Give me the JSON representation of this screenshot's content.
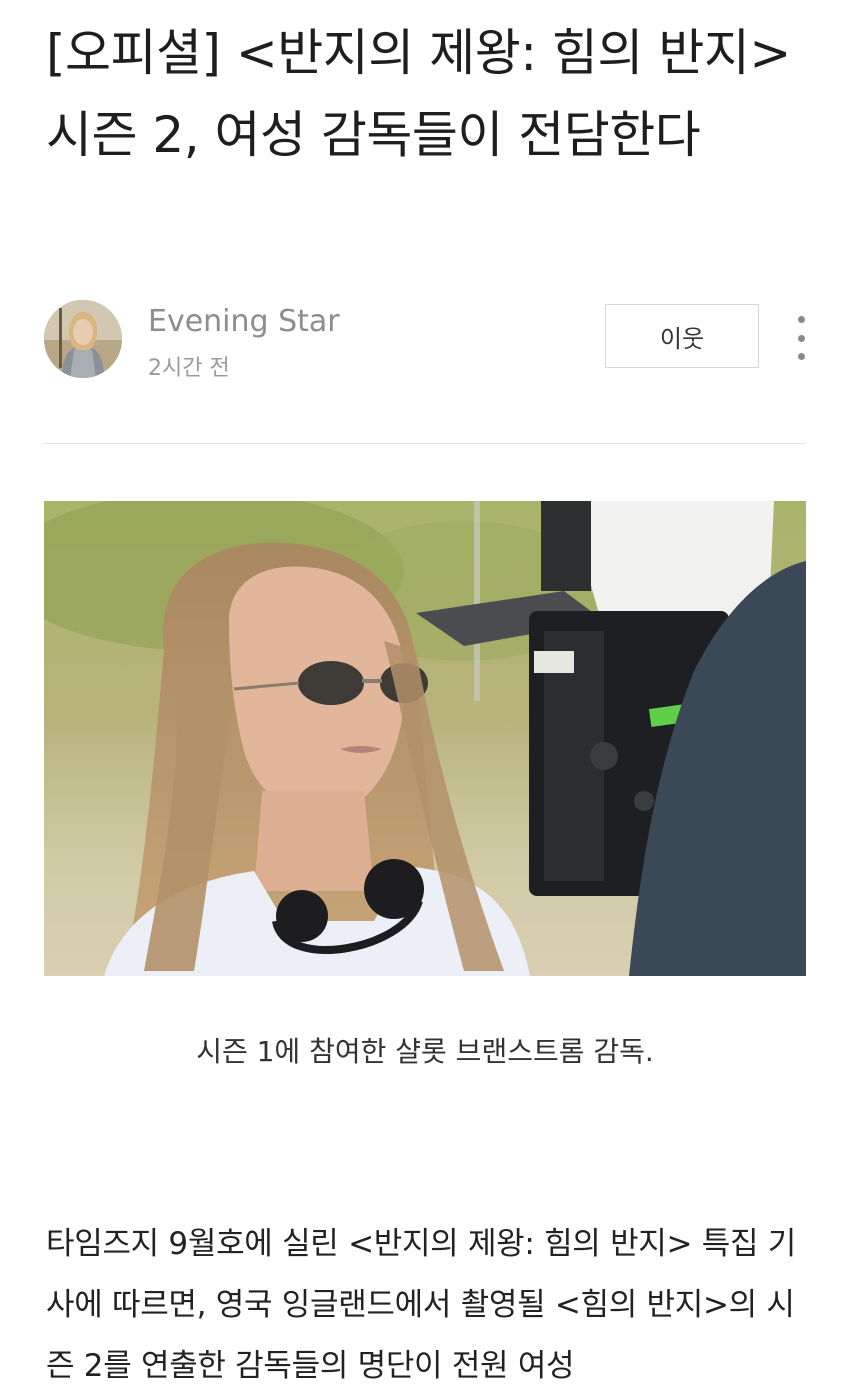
{
  "article": {
    "title": "[오피셜] <반지의 제왕: 힘의 반지> 시즌 2, 여성 감독들이 전담한다",
    "author": {
      "name": "Evening Star",
      "time": "2시간 전",
      "avatar_icon": "author-avatar"
    },
    "follow_label": "이웃",
    "more_icon": "more-vertical-icon",
    "photo": {
      "caption": "시즌 1에 참여한 샬롯 브랜스트롬 감독."
    },
    "body": "타임즈지 9월호에 실린 <반지의 제왕: 힘의 반지> 특집 기사에 따르면, 영국 잉글랜드에서 촬영될 <힘의 반지>의 시즌 2를 연출한 감독들의 명단이 전원 여성"
  },
  "colors": {
    "title": "#1e1e1e",
    "muted": "#8d8d8d",
    "divider": "#e3e3e3",
    "button_border": "#d6d6d6"
  }
}
